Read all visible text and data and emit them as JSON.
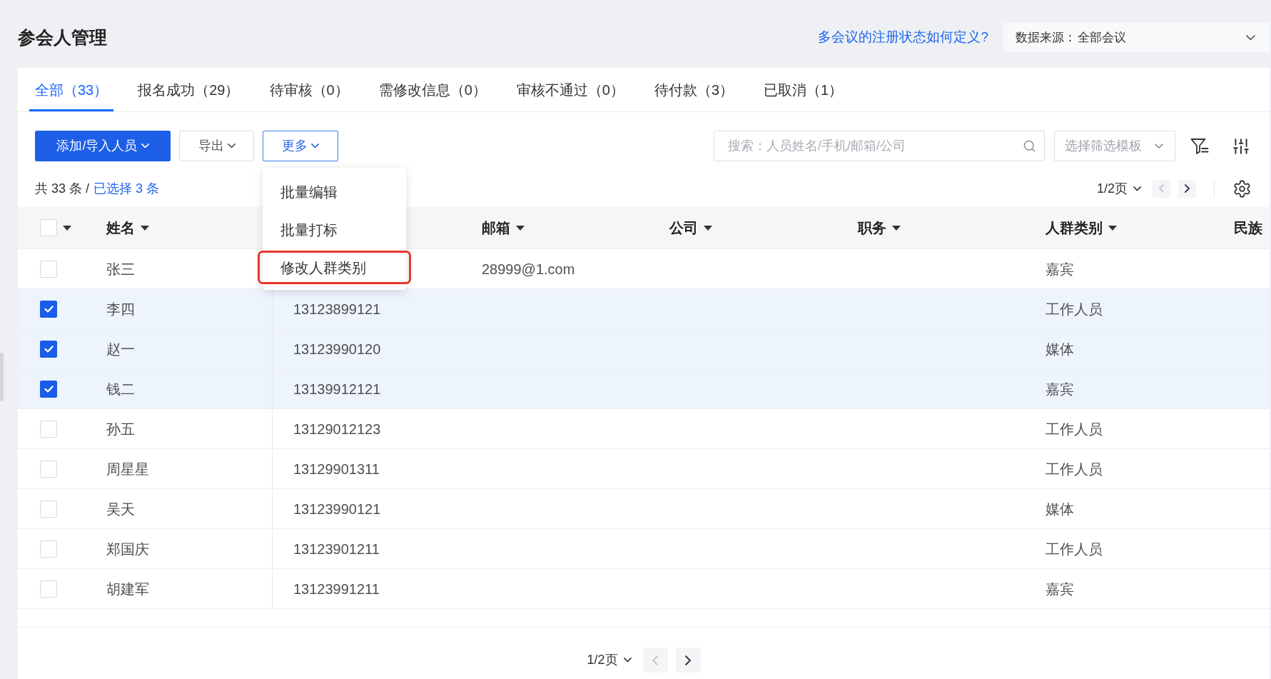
{
  "page_title": "参会人管理",
  "help_link": "多会议的注册状态如何定义?",
  "data_source": {
    "label": "数据来源：",
    "value": "全部会议"
  },
  "tabs": [
    {
      "label": "全部（33）",
      "selected": true
    },
    {
      "label": "报名成功（29）",
      "selected": false
    },
    {
      "label": "待审核（0）",
      "selected": false
    },
    {
      "label": "需修改信息（0）",
      "selected": false
    },
    {
      "label": "审核不通过（0）",
      "selected": false
    },
    {
      "label": "待付款（3）",
      "selected": false
    },
    {
      "label": "已取消（1）",
      "selected": false
    }
  ],
  "toolbar": {
    "buttons": [
      {
        "label": "添加/导入人员",
        "kind": "primary",
        "open": false
      },
      {
        "label": "导出",
        "kind": "default",
        "open": false
      },
      {
        "label": "更多",
        "kind": "default",
        "open": true
      }
    ],
    "menu": [
      {
        "label": "批量编辑",
        "highlighted": false
      },
      {
        "label": "批量打标",
        "highlighted": false
      },
      {
        "label": "修改人群类别",
        "highlighted": true
      }
    ],
    "search": {
      "placeholder": "搜索：人员姓名/手机/邮箱/公司"
    },
    "template_select": {
      "placeholder": "选择筛选模板"
    }
  },
  "summary": {
    "total": "共 33 条 /",
    "selected": "已选择 3 条"
  },
  "pagination_top": {
    "page": "1/2页",
    "prev_disabled": true,
    "next_disabled": false
  },
  "table": {
    "select_all": {
      "checked": false
    },
    "columns": {
      "name": {
        "label": "姓名",
        "dropdown": true
      },
      "email": {
        "label": "邮箱",
        "dropdown": true
      },
      "company": {
        "label": "公司",
        "dropdown": true
      },
      "position": {
        "label": "职务",
        "dropdown": true
      },
      "category": {
        "label": "人群类别",
        "dropdown": true
      },
      "ethnicity": {
        "label": "民族",
        "dropdown": false
      }
    },
    "rows": [
      {
        "checked": false,
        "name": "张三",
        "email": "28999@1.com",
        "category": "嘉宾"
      },
      {
        "checked": true,
        "name": "李四",
        "column_3": "13123899121",
        "category": "工作人员"
      },
      {
        "checked": true,
        "name": "赵一",
        "column_3": "13123990120",
        "category": "媒体"
      },
      {
        "checked": true,
        "name": "钱二",
        "column_3": "13139912121",
        "category": "嘉宾"
      },
      {
        "checked": false,
        "name": "孙五",
        "column_3": "13129012123",
        "category": "工作人员"
      },
      {
        "checked": false,
        "name": "周星星",
        "column_3": "13129901311",
        "category": "工作人员"
      },
      {
        "checked": false,
        "name": "吴天",
        "column_3": "13123990121",
        "category": "媒体"
      },
      {
        "checked": false,
        "name": "郑国庆",
        "column_3": "13123901211",
        "category": "工作人员"
      },
      {
        "checked": false,
        "name": "胡建军",
        "column_3": "13123991211",
        "category": "嘉宾"
      }
    ]
  },
  "pagination_bottom": {
    "page": "1/2页",
    "prev_disabled": true,
    "next_disabled": false
  }
}
